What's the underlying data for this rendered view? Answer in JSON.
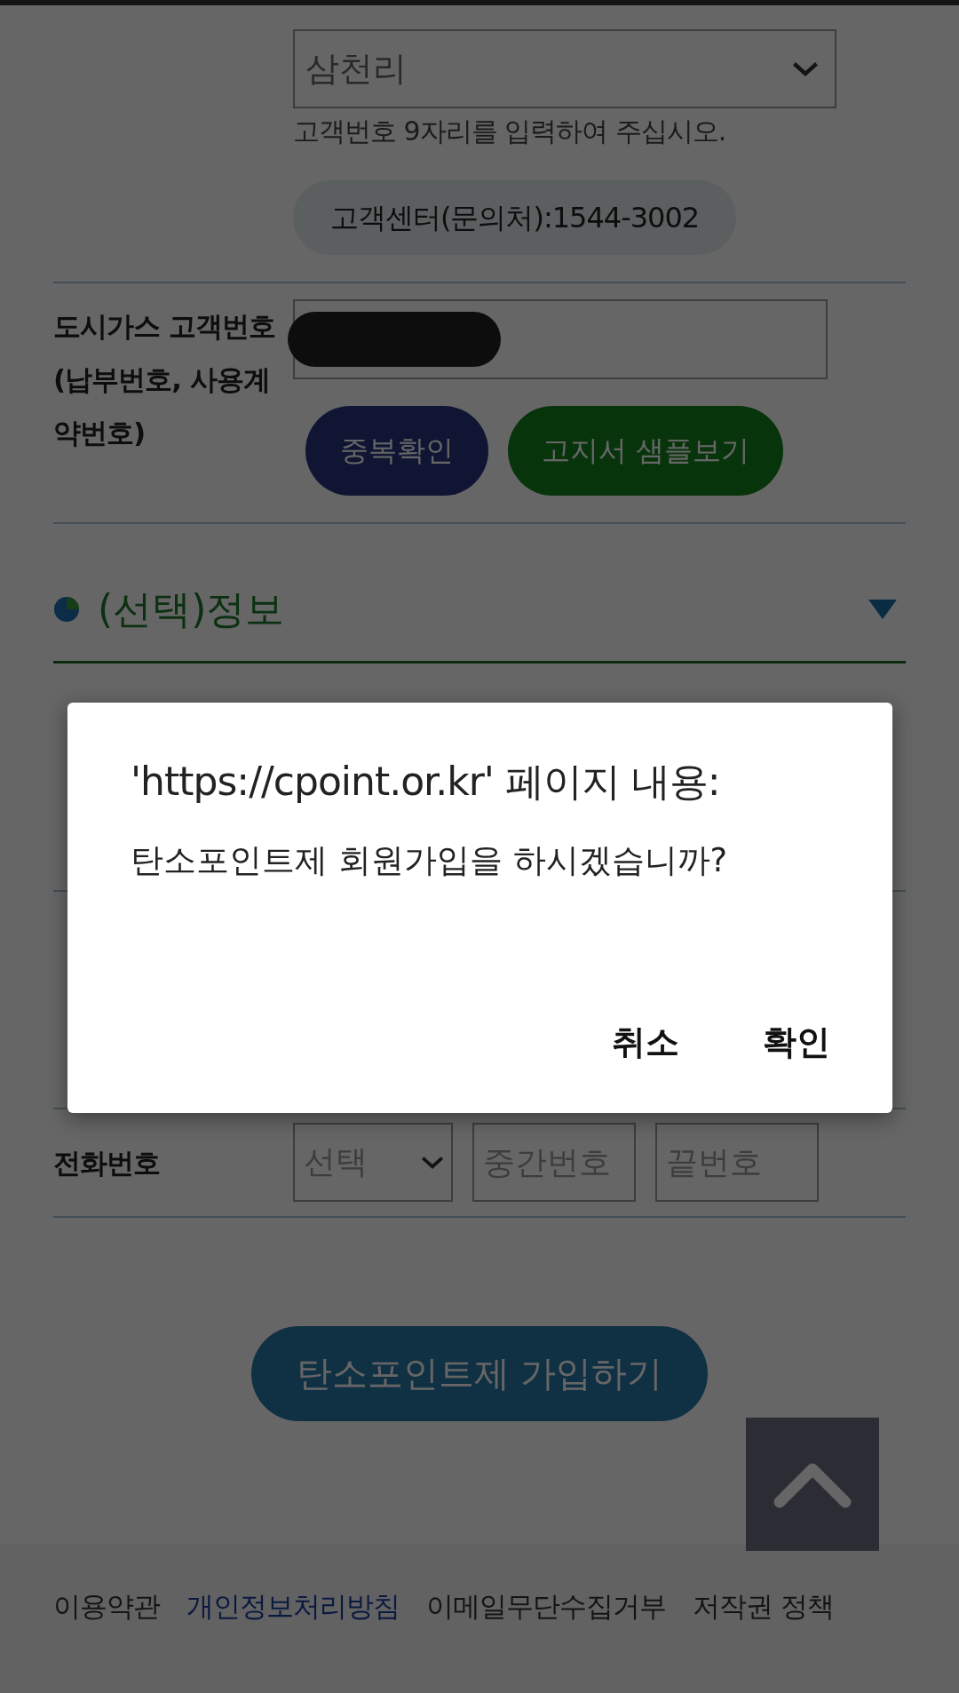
{
  "provider_select": {
    "value": "삼천리"
  },
  "hint": "고객번호 9자리를 입력하여 주십시오.",
  "contact_pill": "고객센터(문의처):1544-3002",
  "gas_customer": {
    "label_lines": [
      "도시가스 고객번호",
      "(납부번호, 사용계약번호)"
    ],
    "redacted": true,
    "buttons": [
      {
        "kind": "check",
        "label": "중복확인"
      },
      {
        "kind": "sample",
        "label": "고지서 샘플보기"
      }
    ]
  },
  "optional_section": {
    "title": "(선택)정보"
  },
  "phone": {
    "label": "전화번호",
    "select_placeholder": "선택",
    "middle_placeholder": "중간번호",
    "last_placeholder": "끝번호"
  },
  "submit_button": "탄소포인트제 가입하기",
  "footer_links": [
    {
      "label": "이용약관",
      "emphasized": false
    },
    {
      "label": "개인정보처리방침",
      "emphasized": true
    },
    {
      "label": "이메일무단수집거부",
      "emphasized": false
    },
    {
      "label": "저작권 정책",
      "emphasized": false
    }
  ],
  "dialog": {
    "title": "'https://cpoint.or.kr' 페이지 내용:",
    "message": "탄소포인트제 회원가입을 하시겠습니까?",
    "buttons": [
      "취소",
      "확인"
    ]
  }
}
